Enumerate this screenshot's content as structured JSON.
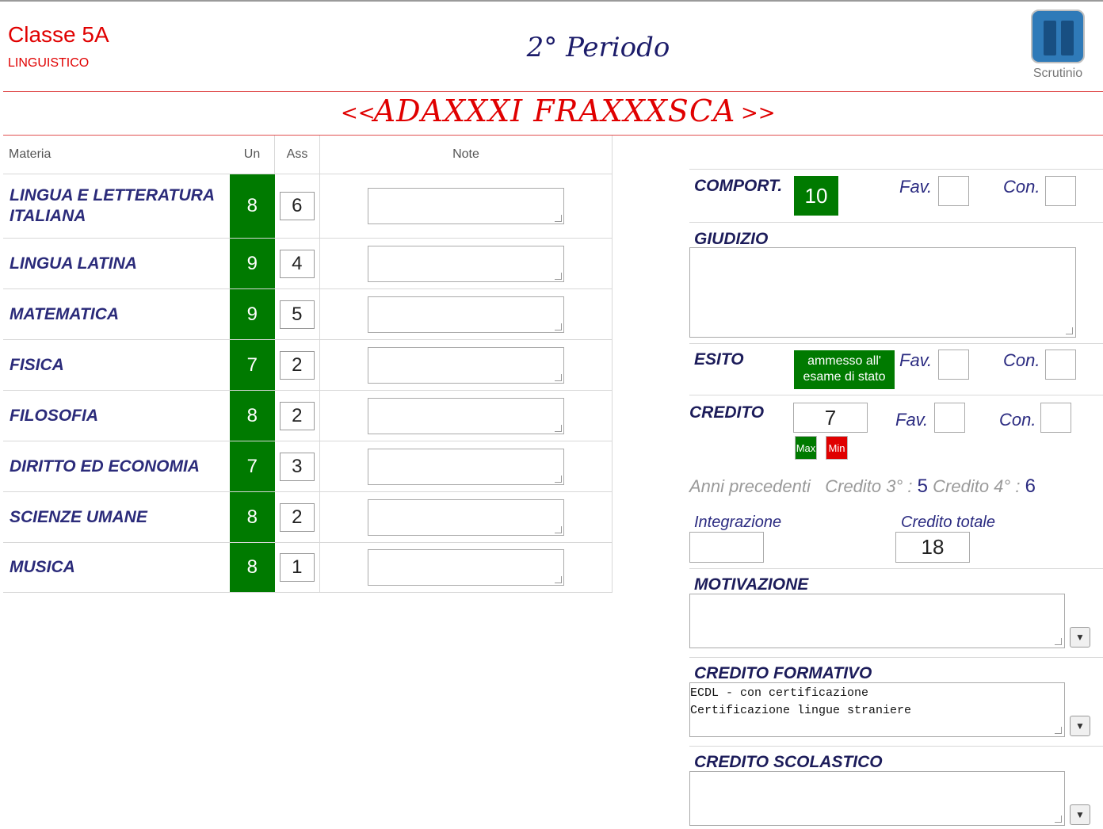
{
  "header": {
    "class_name": "Classe 5A",
    "class_type": "LINGUISTICO",
    "period": "2° Periodo",
    "scrutinio_label": "Scrutinio"
  },
  "student_nav": {
    "prev": "<<",
    "name": "ADAXXXI FRAXXXSCA",
    "next": ">>"
  },
  "table": {
    "headers": {
      "materia": "Materia",
      "un": "Un",
      "ass": "Ass",
      "note": "Note"
    },
    "rows": [
      {
        "subject": "LINGUA E LETTERATURA ITALIANA",
        "un": "8",
        "ass": "6"
      },
      {
        "subject": "LINGUA LATINA",
        "un": "9",
        "ass": "4"
      },
      {
        "subject": "MATEMATICA",
        "un": "9",
        "ass": "5"
      },
      {
        "subject": "FISICA",
        "un": "7",
        "ass": "2"
      },
      {
        "subject": "FILOSOFIA",
        "un": "8",
        "ass": "2"
      },
      {
        "subject": "DIRITTO ED ECONOMIA",
        "un": "7",
        "ass": "3"
      },
      {
        "subject": "SCIENZE UMANE",
        "un": "8",
        "ass": "2"
      },
      {
        "subject": "MUSICA",
        "un": "8",
        "ass": "1"
      }
    ]
  },
  "panel": {
    "comport_label": "COMPORT.",
    "comport_value": "10",
    "fav_label": "Fav.",
    "con_label": "Con.",
    "giudizio_label": "GIUDIZIO",
    "esito_label": "ESITO",
    "esito_value_line1": "ammesso all'",
    "esito_value_line2": "esame di stato",
    "credito_label": "CREDITO",
    "credito_value": "7",
    "max_label": "Max",
    "min_label": "Min",
    "anni_precedenti": "Anni precedenti",
    "credito3_label": "Credito 3° :",
    "credito3_value": "5",
    "credito4_label": "Credito 4° :",
    "credito4_value": "6",
    "integrazione_label": "Integrazione",
    "credito_totale_label": "Credito totale",
    "credito_totale_value": "18",
    "motivazione_label": "MOTIVAZIONE",
    "credito_formativo_label": "CREDITO FORMATIVO",
    "credito_formativo_text": "ECDL - con certificazione\nCertificazione lingue straniere",
    "credito_scolastico_label": "CREDITO SCOLASTICO"
  },
  "colors": {
    "accent_red": "#e00000",
    "grade_green": "#007a00",
    "label_navy": "#2b2b7a"
  }
}
